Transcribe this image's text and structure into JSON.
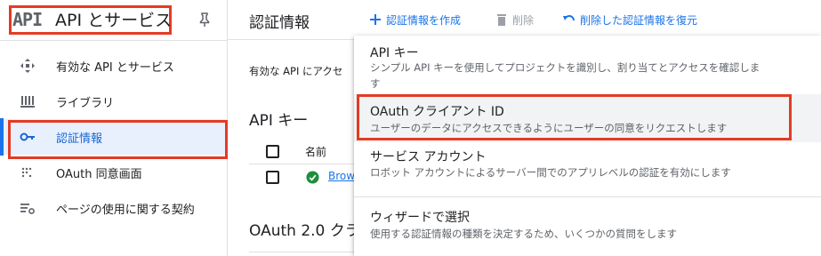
{
  "sidebar": {
    "logo": "API",
    "title": "API とサービス",
    "items": [
      {
        "label": "有効な API とサービス"
      },
      {
        "label": "ライブラリ"
      },
      {
        "label": "認証情報"
      },
      {
        "label": "OAuth 同意画面"
      },
      {
        "label": "ページの使用に関する契約"
      }
    ]
  },
  "topbar": {
    "title": "認証情報",
    "create_label": "認証情報を作成",
    "delete_label": "削除",
    "restore_label": "削除した認証情報を復元"
  },
  "main": {
    "description": "有効な API にアクセ",
    "api_keys_heading": "API キー",
    "table_header_name": "名前",
    "row_name": "Brow",
    "oauth_heading": "OAuth 2.0 クラ"
  },
  "menu": {
    "items": [
      {
        "title": "API キー",
        "description": "シンプル API キーを使用してプロジェクトを識別し、割り当てとアクセスを確認しま\nす"
      },
      {
        "title": "OAuth クライアント ID",
        "description": "ユーザーのデータにアクセスできるようにユーザーの同意をリクエストします"
      },
      {
        "title": "サービス アカウント",
        "description": "ロボット アカウントによるサーバー間でのアプリレベルの認証を有効にします"
      },
      {
        "title": "ウィザードで選択",
        "description": "使用する認証情報の種類を決定するため、いくつかの質問をします"
      }
    ]
  },
  "colors": {
    "accent": "#1a73e8",
    "highlight_box": "#e33b24",
    "active_bg": "#e8f0fe",
    "success": "#1e8e3e"
  },
  "icons": {
    "pin": "pin-icon",
    "enabled_apis": "diamond-arrows-icon",
    "library": "library-icon",
    "credentials": "key-icon",
    "consent": "dotted-grid-icon",
    "agreements": "settings-list-icon",
    "create": "plus-icon",
    "delete": "trash-icon",
    "restore": "undo-icon",
    "status": "check-circle-icon"
  }
}
